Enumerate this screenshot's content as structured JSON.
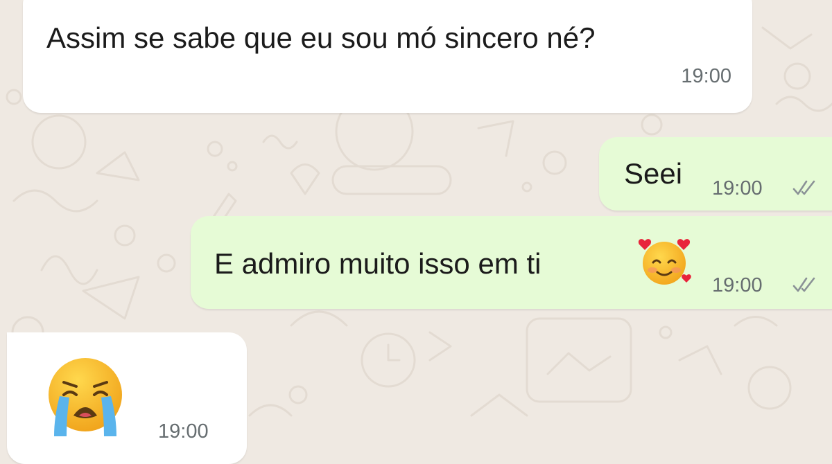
{
  "chat": {
    "messages": [
      {
        "direction": "incoming",
        "text": "Assim se sabe que eu sou mó sincero né?",
        "time": "19:00"
      },
      {
        "direction": "outgoing",
        "text": "Seei",
        "time": "19:00",
        "status": "read"
      },
      {
        "direction": "outgoing",
        "text": "E admiro muito isso em ti",
        "emoji": "smiling-face-with-hearts",
        "time": "19:00",
        "status": "read"
      },
      {
        "direction": "incoming",
        "emoji": "loudly-crying-face",
        "time": "19:00"
      }
    ]
  },
  "colors": {
    "wallpaper": "#efe9e2",
    "incoming_bubble": "#ffffff",
    "outgoing_bubble": "#e6fbd6",
    "timestamp": "#666d70",
    "read_ticks": "#8a9196"
  }
}
